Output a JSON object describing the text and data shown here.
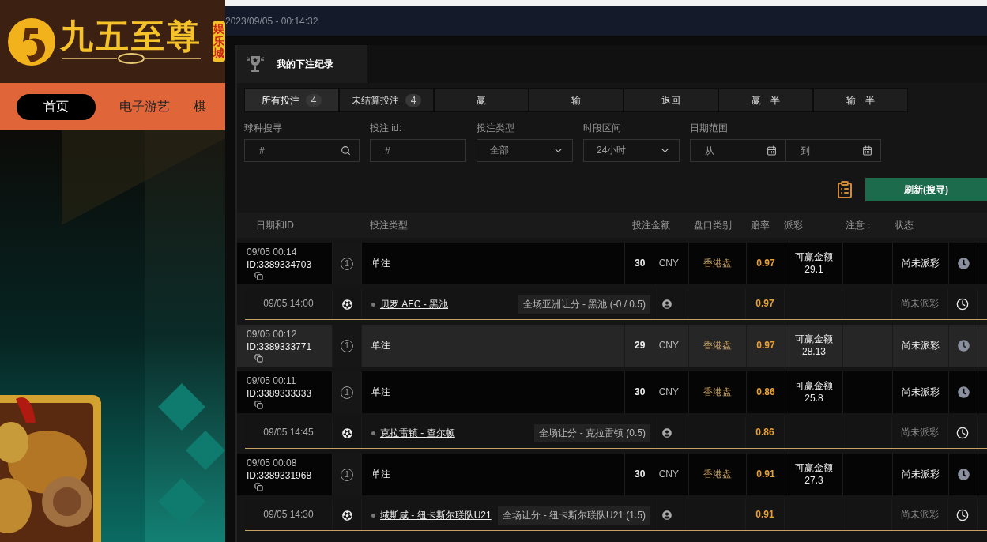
{
  "site": {
    "logo_text": "九五至尊",
    "logo_badge": "娱乐城",
    "nav": [
      {
        "label": "首页",
        "selected": true
      },
      {
        "label": "电子游艺",
        "selected": false
      },
      {
        "label": "棋",
        "selected": false
      }
    ]
  },
  "clock": "2023/09/05 - 00:14:32",
  "panel": {
    "title": "我的下注纪录",
    "tabs": [
      {
        "label": "所有投注",
        "count": "4",
        "selected": true
      },
      {
        "label": "未结算投注",
        "count": "4",
        "selected": false
      },
      {
        "label": "赢",
        "selected": false
      },
      {
        "label": "输",
        "selected": false
      },
      {
        "label": "退回",
        "selected": false
      },
      {
        "label": "赢一半",
        "selected": false
      },
      {
        "label": "输一半",
        "selected": false
      }
    ],
    "filters": [
      {
        "label": "球种搜寻",
        "kind": "search",
        "placeholder": "#"
      },
      {
        "label": "投注 id:",
        "kind": "text",
        "placeholder": "#"
      },
      {
        "label": "投注类型",
        "kind": "select",
        "value": "全部"
      },
      {
        "label": "时段区间",
        "kind": "select",
        "value": "24小时"
      },
      {
        "label": "日期范围",
        "kind": "daterange",
        "from_placeholder": "从",
        "to_placeholder": "到"
      }
    ],
    "refresh_button": "刷新(搜寻)"
  },
  "table": {
    "columns": [
      "日期和ID",
      "投注类型",
      "投注金额",
      "盘口类别",
      "赔率",
      "派彩",
      "注意：",
      "状态"
    ],
    "bets": [
      {
        "date": "09/05 00:14",
        "id": "ID:3389334703",
        "leg_count": "1",
        "bet_type": "单注",
        "amount": "30",
        "currency": "CNY",
        "market_type": "香港盘",
        "odds": "0.97",
        "payout_label": "可赢金额",
        "payout": "29.1",
        "status": "尚未派彩",
        "selected": false,
        "selection": {
          "time": "09/05 14:00",
          "match": "贝罗 AFC - 黑池",
          "market": "全场亚洲让分 - 黑池 (-0 / 0.5)",
          "odds": "0.97",
          "status": "尚未派彩"
        }
      },
      {
        "date": "09/05 00:12",
        "id": "ID:3389333771",
        "leg_count": "1",
        "bet_type": "单注",
        "amount": "29",
        "currency": "CNY",
        "market_type": "香港盘",
        "odds": "0.97",
        "payout_label": "可赢金额",
        "payout": "28.13",
        "status": "尚未派彩",
        "selected": true
      },
      {
        "date": "09/05 00:11",
        "id": "ID:3389333333",
        "leg_count": "1",
        "bet_type": "单注",
        "amount": "30",
        "currency": "CNY",
        "market_type": "香港盘",
        "odds": "0.86",
        "payout_label": "可赢金额",
        "payout": "25.8",
        "status": "尚未派彩",
        "selected": false,
        "selection": {
          "time": "09/05 14:45",
          "match": "克拉雷镇 - 查尔顿",
          "market": "全场让分 - 克拉雷镇 (0.5)",
          "odds": "0.86",
          "status": "尚未派彩"
        }
      },
      {
        "date": "09/05 00:08",
        "id": "ID:3389331968",
        "leg_count": "1",
        "bet_type": "单注",
        "amount": "30",
        "currency": "CNY",
        "market_type": "香港盘",
        "odds": "0.91",
        "payout_label": "可赢金额",
        "payout": "27.3",
        "status": "尚未派彩",
        "selected": false,
        "selection": {
          "time": "09/05 14:30",
          "match": "域斯咸 - 纽卡斯尔联队U21",
          "market": "全场让分 - 纽卡斯尔联队U21 (1.5)",
          "odds": "0.91",
          "status": "尚未派彩"
        }
      }
    ]
  }
}
